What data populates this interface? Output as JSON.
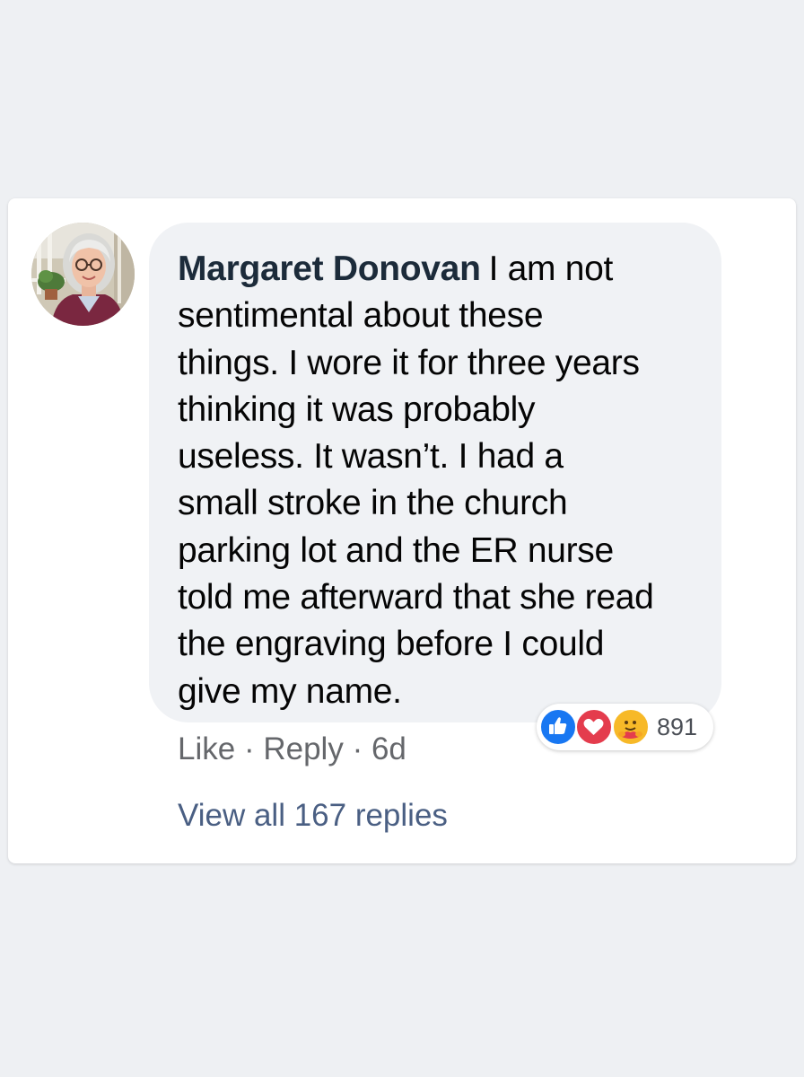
{
  "comment": {
    "author": "Margaret Donovan",
    "lines": [
      "I am not",
      "sentimental about these",
      "things. I wore it for three years",
      "thinking it was probably",
      "useless. It wasn’t. I had a",
      "small stroke in the church",
      "parking lot and the ER nurse",
      "told me afterward that she read",
      "the engraving before I could",
      "give my name."
    ],
    "actions": {
      "like": "Like",
      "separator": "·",
      "reply": "Reply",
      "time": "6d"
    },
    "reactions": {
      "icons": [
        "like-icon",
        "love-icon",
        "care-icon"
      ],
      "count": "891"
    },
    "view_replies": "View all 167 replies"
  },
  "colors": {
    "page_bg": "#eef0f3",
    "bubble_bg": "#f0f2f5",
    "author": "#1c2b3a",
    "action_text": "#65676b",
    "link": "#4a5f83",
    "like_blue": "#1877f2",
    "love_red": "#e43c4d",
    "care_yellow": "#f7b928"
  }
}
